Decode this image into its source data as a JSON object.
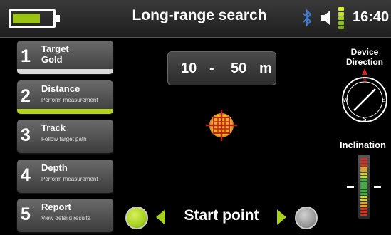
{
  "header": {
    "title": "Long-range search",
    "battery_level": 0.7,
    "time": "16:40",
    "bluetooth_icon": "bluetooth-icon",
    "speaker_icon": "speaker-icon",
    "signal_icon": "signal-level-icon"
  },
  "steps": [
    {
      "number": "1",
      "label": "Target",
      "sub": "Gold",
      "sub_large": true,
      "bar": "#d8d8d8"
    },
    {
      "number": "2",
      "label": "Distance",
      "sub": "Perform measurement",
      "sub_large": false,
      "bar": "#b4d321"
    },
    {
      "number": "3",
      "label": "Track",
      "sub": "Follow target path",
      "sub_large": false,
      "bar": ""
    },
    {
      "number": "4",
      "label": "Depth",
      "sub": "Perform measurement",
      "sub_large": false,
      "bar": ""
    },
    {
      "number": "5",
      "label": "Report",
      "sub": "View detaild results",
      "sub_large": false,
      "bar": ""
    }
  ],
  "distance": {
    "from": "10",
    "separator": "-",
    "to": "50",
    "unit": "m"
  },
  "target_icon": "crosshair-target-icon",
  "navigation": {
    "label": "Start point",
    "left_indicator_color": "#a6d21e",
    "right_indicator_color": "#9a9a9a",
    "arrow_color": "#a6d21e"
  },
  "compass": {
    "title_line1": "Device",
    "title_line2": "Direction",
    "north": "N",
    "east": "E",
    "south": "S",
    "west": "W",
    "north_marker_color": "#e02020"
  },
  "inclination": {
    "label": "Inclination",
    "level": 0.5
  },
  "colors": {
    "accent": "#a6d21e",
    "background": "#000000",
    "panel": "#4a4a4a"
  }
}
